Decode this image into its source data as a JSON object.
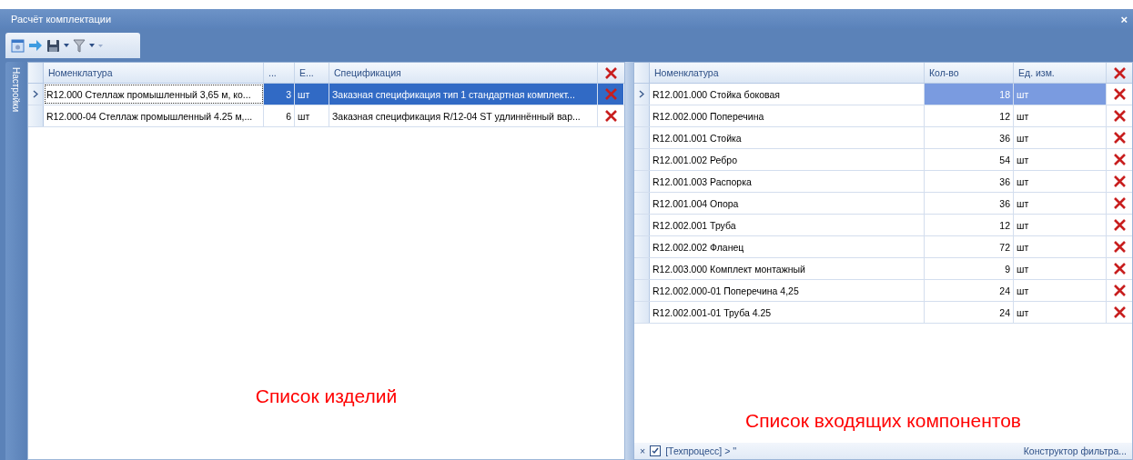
{
  "window": {
    "title": "Расчёт комплектации",
    "close": "×"
  },
  "side_tab": {
    "label": "Настройки"
  },
  "left_grid": {
    "focused": true,
    "columns": [
      "Номенклатура",
      "...",
      "Е...",
      "Спецификация"
    ],
    "rows": [
      {
        "selected": true,
        "cells": [
          "R12.000 Стеллаж промышленный 3,65 м, ко...",
          "3",
          "шт",
          "Заказная спецификация тип 1 стандартная комплект..."
        ]
      },
      {
        "selected": false,
        "cells": [
          "R12.000-04 Стеллаж промышленный 4.25 м,...",
          "6",
          "шт",
          "Заказная спецификация R/12-04 ST удлиннённый вар..."
        ]
      }
    ],
    "caption": "Список изделий"
  },
  "right_grid": {
    "focused": false,
    "columns": [
      "Номенклатура",
      "Кол-во",
      "Ед. изм."
    ],
    "rows": [
      {
        "selected": true,
        "cells": [
          "R12.001.000 Стойка боковая",
          "18",
          "шт"
        ]
      },
      {
        "selected": false,
        "cells": [
          "R12.002.000 Поперечина",
          "12",
          "шт"
        ]
      },
      {
        "selected": false,
        "cells": [
          "R12.001.001 Стойка",
          "36",
          "шт"
        ]
      },
      {
        "selected": false,
        "cells": [
          "R12.001.002 Ребро",
          "54",
          "шт"
        ]
      },
      {
        "selected": false,
        "cells": [
          "R12.001.003 Распорка",
          "36",
          "шт"
        ]
      },
      {
        "selected": false,
        "cells": [
          "R12.001.004 Опора",
          "36",
          "шт"
        ]
      },
      {
        "selected": false,
        "cells": [
          "R12.002.001 Труба",
          "12",
          "шт"
        ]
      },
      {
        "selected": false,
        "cells": [
          "R12.002.002 Фланец",
          "72",
          "шт"
        ]
      },
      {
        "selected": false,
        "cells": [
          "R12.003.000 Комплект монтажный",
          "9",
          "шт"
        ]
      },
      {
        "selected": false,
        "cells": [
          "R12.002.000-01 Поперечина 4,25",
          "24",
          "шт"
        ]
      },
      {
        "selected": false,
        "cells": [
          "R12.002.001-01 Труба 4.25",
          "24",
          "шт"
        ]
      }
    ],
    "caption": "Список входящих компонентов",
    "filter_bar": {
      "clear": "×",
      "checked": true,
      "expression": "[Техпроцесс] > ''",
      "builder_link": "Конструктор фильтра..."
    }
  }
}
